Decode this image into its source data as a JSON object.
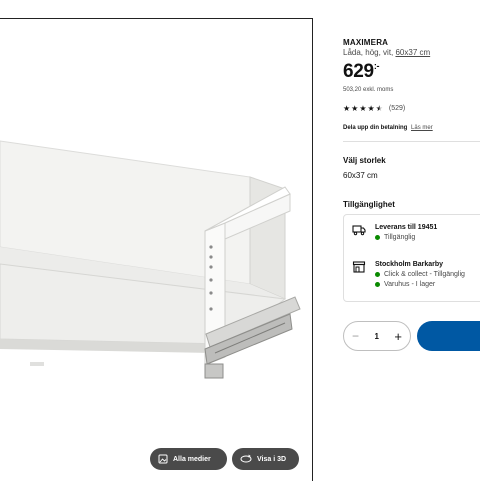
{
  "media": {
    "all_media_label": "Alla medier",
    "view_3d_label": "Visa i 3D",
    "all_media_icon": "gallery-icon",
    "view_3d_icon": "rotate-3d-icon"
  },
  "product": {
    "name": "MAXIMERA",
    "description_prefix": "Låda, hög, vit, ",
    "size_link": "60x37 cm",
    "price_main": "629",
    "price_suffix": ":-",
    "price_ex_vat": "503,20 exkl. moms",
    "rating": {
      "stars": 4.5,
      "count": "(529)"
    },
    "split_payment": "Dela upp din betalning",
    "read_more": "Läs mer"
  },
  "size": {
    "title": "Välj storlek",
    "value": "60x37 cm"
  },
  "availability": {
    "title": "Tillgänglighet",
    "delivery": {
      "icon": "truck-icon",
      "title": "Leverans till 19451",
      "status": "Tillgänglig"
    },
    "store": {
      "icon": "store-icon",
      "title": "Stockholm Barkarby",
      "click_collect": "Click & collect - Tillgänglig",
      "warehouse": "Varuhus - I lager"
    },
    "status_color": "#0a8a00"
  },
  "quantity": {
    "value": "1",
    "minus": "−",
    "plus": "+"
  },
  "colors": {
    "primary": "#0058a3",
    "media_button": "#4a4a4a"
  }
}
